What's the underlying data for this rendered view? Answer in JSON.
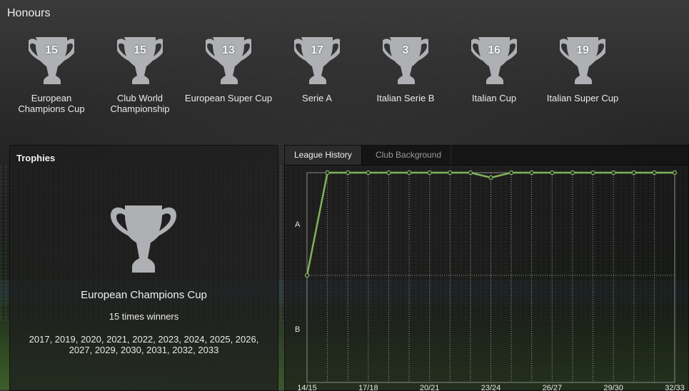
{
  "honours": {
    "title": "Honours",
    "items": [
      {
        "count": "15",
        "name": "European Champions Cup"
      },
      {
        "count": "15",
        "name": "Club World Championship"
      },
      {
        "count": "13",
        "name": "European Super Cup"
      },
      {
        "count": "17",
        "name": "Serie A"
      },
      {
        "count": "3",
        "name": "Italian Serie B"
      },
      {
        "count": "16",
        "name": "Italian Cup"
      },
      {
        "count": "19",
        "name": "Italian Super Cup"
      }
    ]
  },
  "trophies": {
    "title": "Trophies",
    "selected_name": "European Champions Cup",
    "times": "15 times winners",
    "years": "2017, 2019, 2020, 2021, 2022, 2023, 2024, 2025, 2026, 2027, 2029, 2030, 2031, 2032, 2033"
  },
  "tabs": [
    {
      "label": "League History",
      "active": true
    },
    {
      "label": "Club Background",
      "active": false
    }
  ],
  "colors": {
    "line": "#7fb35a",
    "cup": "#aeb0b3"
  },
  "chart_data": {
    "type": "line",
    "x": [
      "14/15",
      "15/16",
      "16/17",
      "17/18",
      "18/19",
      "19/20",
      "20/21",
      "21/22",
      "22/23",
      "23/24",
      "24/25",
      "25/26",
      "26/27",
      "27/28",
      "28/29",
      "29/30",
      "30/31",
      "31/32",
      "32/33"
    ],
    "x_tick_labels": [
      "14/15",
      "17/18",
      "20/21",
      "23/24",
      "26/27",
      "29/30",
      "32/33"
    ],
    "y_levels": [
      "A",
      "B"
    ],
    "series": [
      {
        "values": [
          "B",
          "A",
          "A",
          "A",
          "A",
          "A",
          "A",
          "A",
          "A",
          "A",
          "A",
          "A",
          "A",
          "A",
          "A",
          "A",
          "A",
          "A",
          "A"
        ],
        "position": [
          2,
          1,
          1,
          1,
          1,
          1,
          1,
          1,
          1,
          2,
          1,
          1,
          1,
          1,
          1,
          1,
          1,
          1,
          1
        ]
      }
    ],
    "grid": true
  }
}
